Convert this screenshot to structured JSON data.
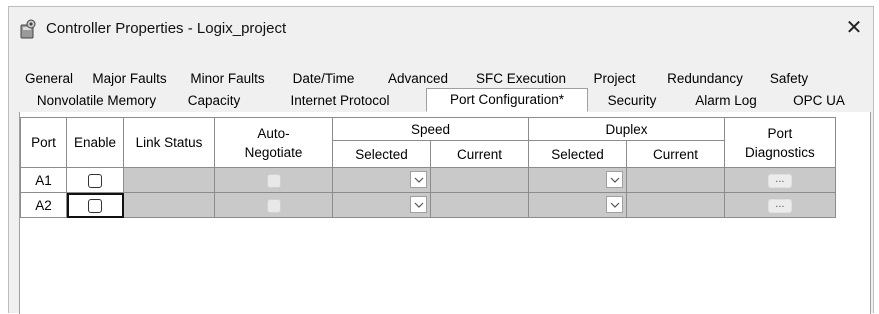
{
  "window": {
    "title": "Controller Properties - Logix_project",
    "close_label": "✕"
  },
  "tabs": {
    "row1": [
      "General",
      "Major Faults",
      "Minor Faults",
      "Date/Time",
      "Advanced",
      "SFC Execution",
      "Project",
      "Redundancy",
      "Safety"
    ],
    "row2": [
      "Nonvolatile Memory",
      "Capacity",
      "Internet Protocol",
      "Port Configuration*",
      "Security",
      "Alarm Log",
      "OPC UA"
    ],
    "active": "Port Configuration*"
  },
  "table": {
    "headers": {
      "port": "Port",
      "enable": "Enable",
      "link_status": "Link Status",
      "auto_negotiate": "Auto-Negotiate",
      "speed": "Speed",
      "duplex": "Duplex",
      "port_diagnostics": "Port Diagnostics",
      "selected": "Selected",
      "current": "Current"
    },
    "rows": [
      {
        "port": "A1",
        "enable": false,
        "link_status": "",
        "auto_negotiate": false,
        "speed_selected": "",
        "speed_current": "",
        "duplex_selected": "",
        "duplex_current": "",
        "diagnostics_button": "..."
      },
      {
        "port": "A2",
        "enable": false,
        "link_status": "",
        "auto_negotiate": false,
        "speed_selected": "",
        "speed_current": "",
        "duplex_selected": "",
        "duplex_current": "",
        "diagnostics_button": "..."
      }
    ]
  },
  "icons": {
    "title": "controller-properties-icon",
    "close": "close-icon",
    "dropdown": "chevron-down-icon"
  }
}
